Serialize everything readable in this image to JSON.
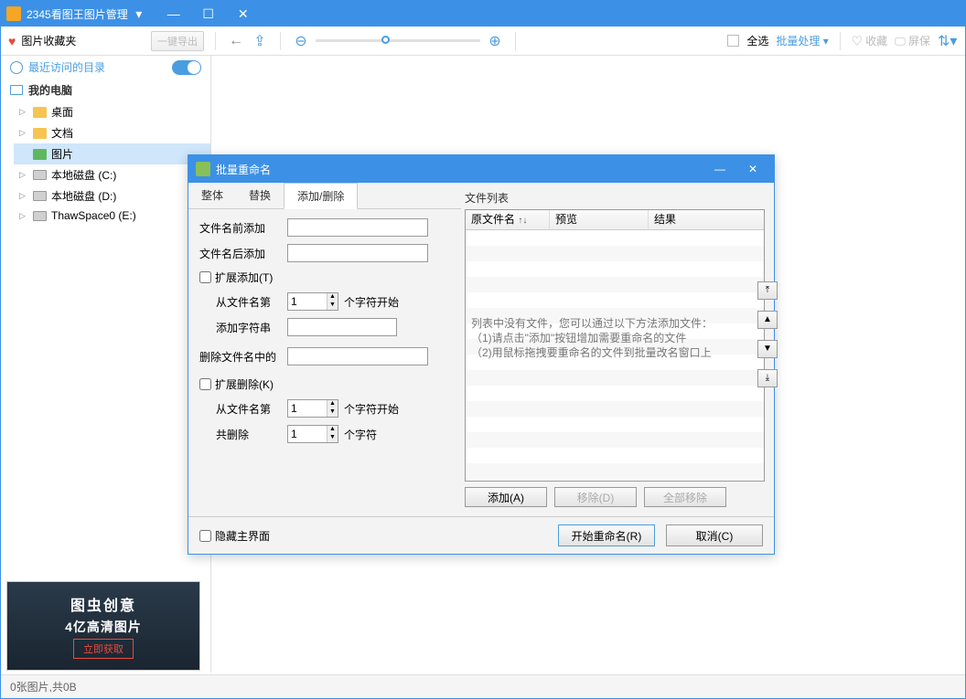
{
  "titlebar": {
    "title": "2345看图王图片管理"
  },
  "sidebar": {
    "favorites": "图片收藏夹",
    "export": "一键导出",
    "recent": "最近访问的目录",
    "computer": "我的电脑",
    "items": [
      {
        "label": "桌面"
      },
      {
        "label": "文档"
      },
      {
        "label": "图片"
      },
      {
        "label": "本地磁盘 (C:)"
      },
      {
        "label": "本地磁盘 (D:)"
      },
      {
        "label": "ThawSpace0 (E:)"
      }
    ]
  },
  "toolbar": {
    "select_all": "全选",
    "batch": "批量处理",
    "favorite": "收藏",
    "screensaver": "屏保"
  },
  "ad": {
    "line1": "图虫创意",
    "line2": "4亿高清图片",
    "cta": "立即获取"
  },
  "status": "0张图片,共0B",
  "dialog": {
    "title": "批量重命名",
    "tabs": [
      "整体",
      "替换",
      "添加/删除"
    ],
    "prefix_label": "文件名前添加",
    "suffix_label": "文件名后添加",
    "ext_add": "扩展添加(T)",
    "from_char": "从文件名第",
    "char_start": "个字符开始",
    "add_str": "添加字符串",
    "del_in_name": "删除文件名中的",
    "ext_del": "扩展删除(K)",
    "total_del": "共删除",
    "chars": "个字符",
    "spin_val": "1",
    "file_list_label": "文件列表",
    "cols": {
      "orig": "原文件名",
      "preview": "预览",
      "result": "结果"
    },
    "empty_msg": "列表中没有文件，您可以通过以下方法添加文件：\n（1)请点击\"添加\"按钮增加需要重命名的文件\n（2)用鼠标拖拽要重命名的文件到批量改名窗口上",
    "add_btn": "添加(A)",
    "remove_btn": "移除(D)",
    "remove_all_btn": "全部移除",
    "hide_main": "隐藏主界面",
    "start": "开始重命名(R)",
    "cancel": "取消(C)"
  }
}
